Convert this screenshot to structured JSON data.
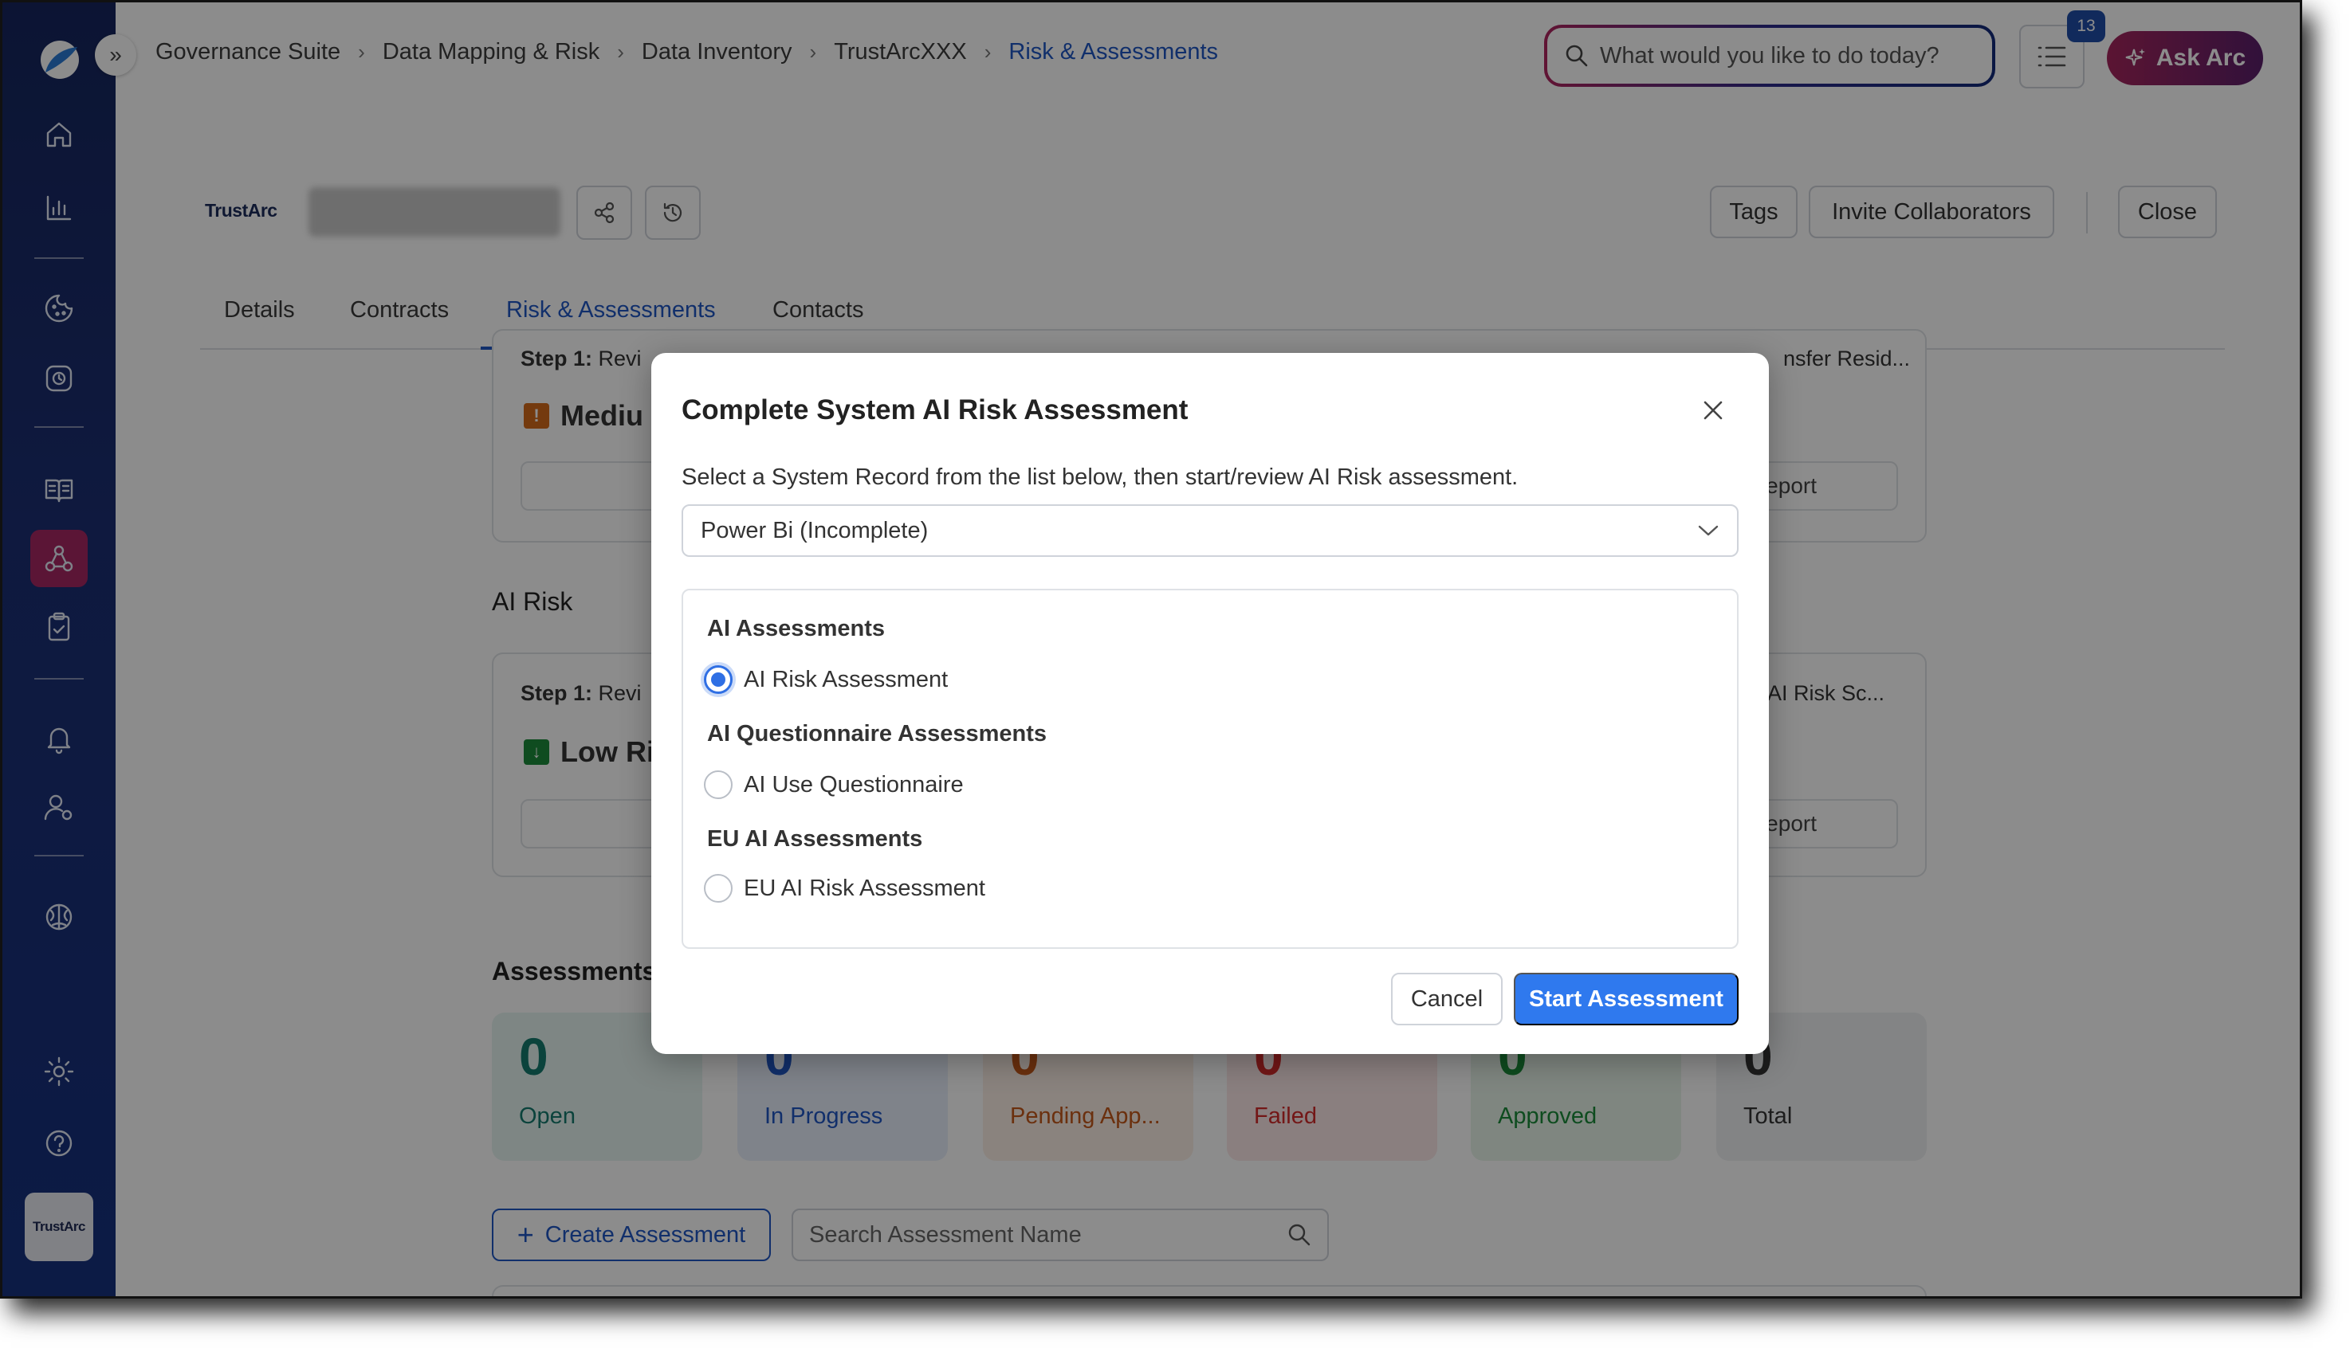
{
  "topbar": {
    "breadcrumb": [
      "Governance Suite",
      "Data Mapping & Risk",
      "Data Inventory",
      "TrustArcXXX",
      "Risk & Assessments"
    ],
    "search_placeholder": "What would you like to do today?",
    "notification_count": "13",
    "ask_label": "Ask Arc"
  },
  "sidebar": {
    "brand": "TrustArc",
    "items": [
      "home-icon",
      "analytics-icon",
      "cookie-icon",
      "consent-icon",
      "catalog-icon",
      "data-mapping-icon",
      "assessment-icon",
      "notifications-icon",
      "user-settings-icon",
      "ai-brain-icon",
      "settings-icon",
      "help-icon"
    ],
    "active_color": "#a72763"
  },
  "header": {
    "logo": "TrustArc",
    "buttons": {
      "tags": "Tags",
      "invite": "Invite Collaborators",
      "close": "Close"
    }
  },
  "tabs": [
    "Details",
    "Contracts",
    "Risk & Assessments",
    "Contacts"
  ],
  "background": {
    "card1": {
      "step_bold": "Step 1:",
      "step_text": "Revi",
      "step_right": "nsfer Resid...",
      "risk": "Mediu",
      "report": "eport"
    },
    "ai_risk_title": "AI Risk",
    "card2": {
      "step_bold": "Step 1:",
      "step_text": "Revi",
      "step_right": "AI Risk Sc...",
      "risk": "Low Ri",
      "report": "eport"
    },
    "assessments_title": "Assessments",
    "stats": [
      {
        "value": "0",
        "label": "Open",
        "color": "#157a6e",
        "bg": "#e6f4f1"
      },
      {
        "value": "0",
        "label": "In Progress",
        "color": "#1f57c3",
        "bg": "#e8eefb"
      },
      {
        "value": "0",
        "label": "Pending App...",
        "color": "#c4581b",
        "bg": "#fcefe6"
      },
      {
        "value": "0",
        "label": "Failed",
        "color": "#d22b2b",
        "bg": "#fbe7e7"
      },
      {
        "value": "0",
        "label": "Approved",
        "color": "#1b8a3a",
        "bg": "#e7f5ea"
      },
      {
        "value": "0",
        "label": "Total",
        "color": "#333333",
        "bg": "#eef0f3"
      }
    ],
    "create_label": "Create Assessment",
    "search_placeholder": "Search Assessment Name"
  },
  "modal": {
    "title": "Complete System AI Risk Assessment",
    "description": "Select a System Record from the list below, then start/review AI Risk assessment.",
    "selected_record": "Power Bi (Incomplete)",
    "groups": [
      {
        "label": "AI Assessments",
        "option": "AI Risk Assessment",
        "checked": true
      },
      {
        "label": "AI Questionnaire Assessments",
        "option": "AI Use Questionnaire",
        "checked": false
      },
      {
        "label": "EU AI Assessments",
        "option": "EU AI Risk Assessment",
        "checked": false
      }
    ],
    "cancel_label": "Cancel",
    "start_label": "Start Assessment"
  }
}
